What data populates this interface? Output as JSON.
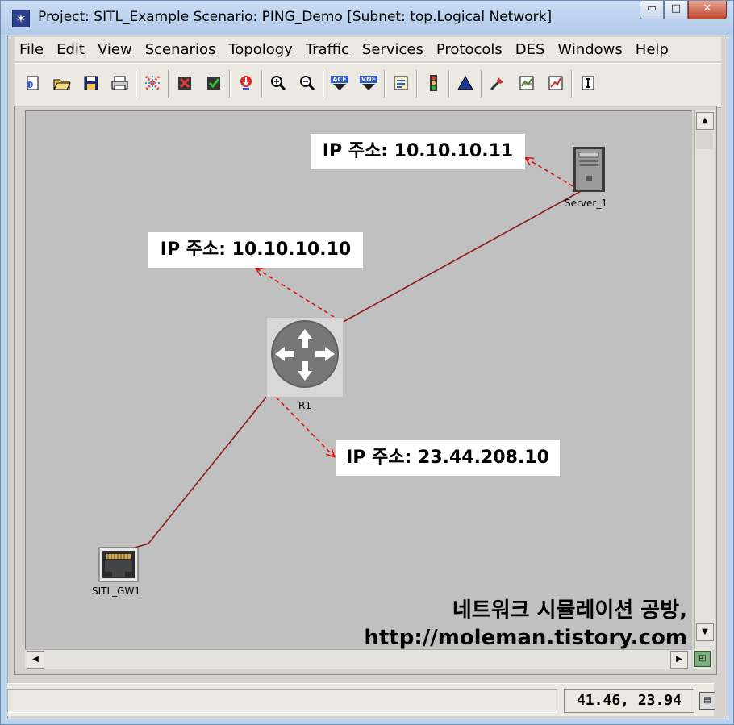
{
  "window": {
    "title": "Project: SITL_Example Scenario: PING_Demo  [Subnet: top.Logical Network]",
    "app_icon": "star-icon",
    "minimize_glyph": "▭",
    "maximize_glyph": "□",
    "close_glyph": "✕"
  },
  "menu": [
    "File",
    "Edit",
    "View",
    "Scenarios",
    "Topology",
    "Traffic",
    "Services",
    "Protocols",
    "DES",
    "Windows",
    "Help"
  ],
  "toolbar": {
    "icons": [
      "new-icon",
      "open-icon",
      "save-icon",
      "print-icon",
      "object-palette-icon",
      "fail-node-icon",
      "check-link-icon",
      "import-icon",
      "zoom-in-icon",
      "zoom-out-icon",
      "ace-icon",
      "vne-icon",
      "configure-traffic-icon",
      "run-simulation-icon",
      "view-results-icon",
      "hide-results-icon",
      "edit-graph-icon",
      "statistics-icon",
      "report-icon"
    ],
    "ace_label": "ACE",
    "vne_label": "VNE"
  },
  "network": {
    "nodes": [
      {
        "id": "server",
        "label": "Server_1",
        "icon": "server-icon"
      },
      {
        "id": "router",
        "label": "R1",
        "icon": "router-icon"
      },
      {
        "id": "gateway",
        "label": "SITL_GW1",
        "icon": "sitl-gateway-icon"
      }
    ],
    "ip_labels": [
      {
        "text": "IP 주소: 10.10.10.11"
      },
      {
        "text": "IP 주소: 10.10.10.10"
      },
      {
        "text": "IP 주소: 23.44.208.10"
      }
    ],
    "link_color": "#8b1a1a",
    "arrow_color": "#e01010"
  },
  "watermark": {
    "line1": "네트워크 시뮬레이션 공방,",
    "line2": "http://moleman.tistory.com"
  },
  "scroll": {
    "up": "▲",
    "down": "▼",
    "left": "◀",
    "right": "▶"
  },
  "status": {
    "coordinates": "41.46, 23.94"
  }
}
